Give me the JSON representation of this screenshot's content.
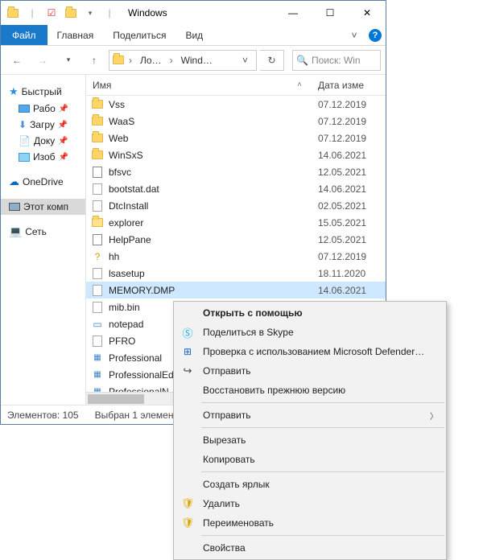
{
  "title": "Windows",
  "ribbon": {
    "file": "Файл",
    "tabs": [
      "Главная",
      "Поделиться",
      "Вид"
    ]
  },
  "breadcrumb": {
    "seg1": "Ло…",
    "seg2": "Wind…"
  },
  "search": {
    "placeholder": "Поиск: Win"
  },
  "tree": {
    "quick": "Быстрый",
    "pinned": [
      "Рабо",
      "Загру",
      "Доку",
      "Изоб"
    ],
    "onedrive": "OneDrive",
    "thispc": "Этот комп",
    "network": "Сеть"
  },
  "columns": {
    "name": "Имя",
    "date": "Дата изме"
  },
  "files": [
    {
      "name": "Vss",
      "date": "07.12.2019",
      "type": "folder"
    },
    {
      "name": "WaaS",
      "date": "07.12.2019",
      "type": "folder"
    },
    {
      "name": "Web",
      "date": "07.12.2019",
      "type": "folder"
    },
    {
      "name": "WinSxS",
      "date": "14.06.2021",
      "type": "folder"
    },
    {
      "name": "bfsvc",
      "date": "12.05.2021",
      "type": "app"
    },
    {
      "name": "bootstat.dat",
      "date": "14.06.2021",
      "type": "file"
    },
    {
      "name": "DtcInstall",
      "date": "02.05.2021",
      "type": "file"
    },
    {
      "name": "explorer",
      "date": "15.05.2021",
      "type": "explorer"
    },
    {
      "name": "HelpPane",
      "date": "12.05.2021",
      "type": "app"
    },
    {
      "name": "hh",
      "date": "07.12.2019",
      "type": "help"
    },
    {
      "name": "lsasetup",
      "date": "18.11.2020",
      "type": "file"
    },
    {
      "name": "MEMORY.DMP",
      "date": "14.06.2021",
      "type": "file",
      "selected": true
    },
    {
      "name": "mib.bin",
      "date": "",
      "type": "file"
    },
    {
      "name": "notepad",
      "date": "",
      "type": "notepad"
    },
    {
      "name": "PFRO",
      "date": "",
      "type": "file"
    },
    {
      "name": "Professional",
      "date": "",
      "type": "xml"
    },
    {
      "name": "ProfessionalEd",
      "date": "",
      "type": "xml"
    },
    {
      "name": "ProfessionalN",
      "date": "",
      "type": "xml"
    }
  ],
  "status": {
    "count": "Элементов: 105",
    "selection": "Выбран 1 элемен"
  },
  "ctx": {
    "open_with": "Открыть с помощью",
    "skype": "Поделиться в Skype",
    "defender": "Проверка с использованием Microsoft Defender…",
    "share": "Отправить",
    "restore": "Восстановить прежнюю версию",
    "sendto": "Отправить",
    "cut": "Вырезать",
    "copy": "Копировать",
    "shortcut": "Создать ярлык",
    "delete": "Удалить",
    "rename": "Переименовать",
    "properties": "Свойства"
  }
}
